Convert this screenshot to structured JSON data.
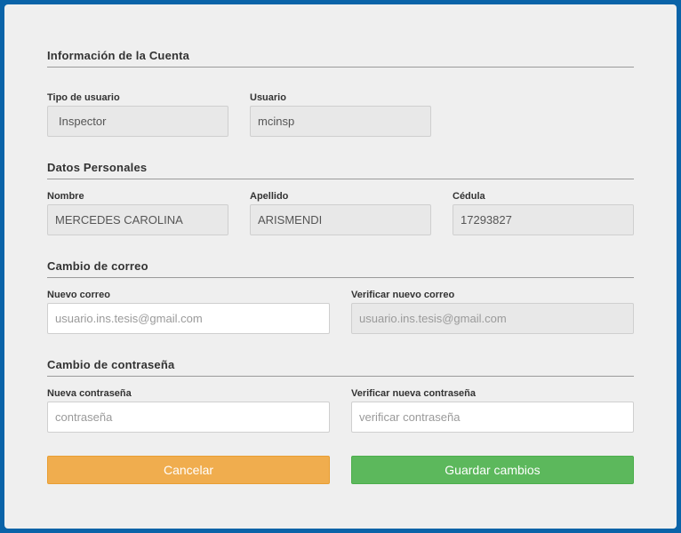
{
  "sections": {
    "account": {
      "title": "Información de la Cuenta"
    },
    "personal": {
      "title": "Datos Personales"
    },
    "email": {
      "title": "Cambio de correo"
    },
    "password": {
      "title": "Cambio de contraseña"
    }
  },
  "fields": {
    "user_type": {
      "label": "Tipo de usuario",
      "value": "Inspector"
    },
    "username": {
      "label": "Usuario",
      "value": "mcinsp"
    },
    "first_name": {
      "label": "Nombre",
      "value": "MERCEDES CAROLINA"
    },
    "last_name": {
      "label": "Apellido",
      "value": "ARISMENDI"
    },
    "id_number": {
      "label": "Cédula",
      "value": "17293827"
    },
    "new_email": {
      "label": "Nuevo correo",
      "placeholder": "usuario.ins.tesis@gmail.com"
    },
    "verify_email": {
      "label": "Verificar nuevo correo",
      "placeholder": "usuario.ins.tesis@gmail.com"
    },
    "new_password": {
      "label": "Nueva contraseña",
      "placeholder": "contraseña"
    },
    "verify_password": {
      "label": "Verificar nueva contraseña",
      "placeholder": "verificar contraseña"
    }
  },
  "buttons": {
    "cancel": "Cancelar",
    "save": "Guardar cambios"
  },
  "colors": {
    "background": "#0a63a8",
    "card": "#efefef",
    "cancel": "#f0ad4e",
    "save": "#5cb85c"
  }
}
